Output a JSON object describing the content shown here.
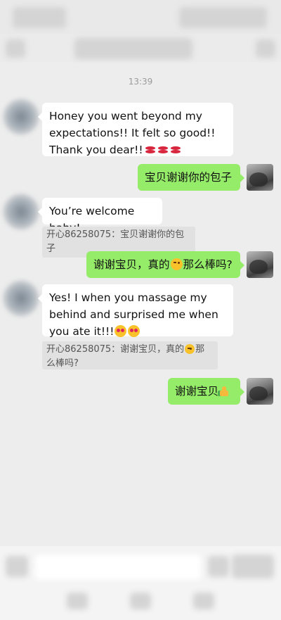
{
  "chat": {
    "timestamp": "13:39",
    "messages": [
      {
        "side": "in",
        "text": "Honey you went beyond my expectations!! It felt so good!! Thank you dear!!",
        "emoji": "kiss-lips"
      },
      {
        "side": "out",
        "text": "宝贝谢谢你的包子"
      },
      {
        "side": "in",
        "text": "You’re welcome baby!",
        "quote": "开心86258075：宝贝谢谢你的包子"
      },
      {
        "side": "out",
        "text_before": "谢谢宝贝，真的",
        "text_after": "那么棒吗?",
        "emoji": "wink-face"
      },
      {
        "side": "in",
        "text": "Yes! I when you massage my behind and surprised me when you ate it!!!",
        "emoji": "heart-eyes-face",
        "quote_before": "开心86258075：谢谢宝贝，真的",
        "quote_after": "那么棒吗?"
      },
      {
        "side": "out",
        "text": "谢谢宝贝",
        "emoji": "thumbs-up"
      }
    ]
  },
  "colors": {
    "background": "#ededed",
    "bubble_out": "#95ec69",
    "bubble_in": "#ffffff",
    "quote_bg": "#e1e1e1"
  }
}
